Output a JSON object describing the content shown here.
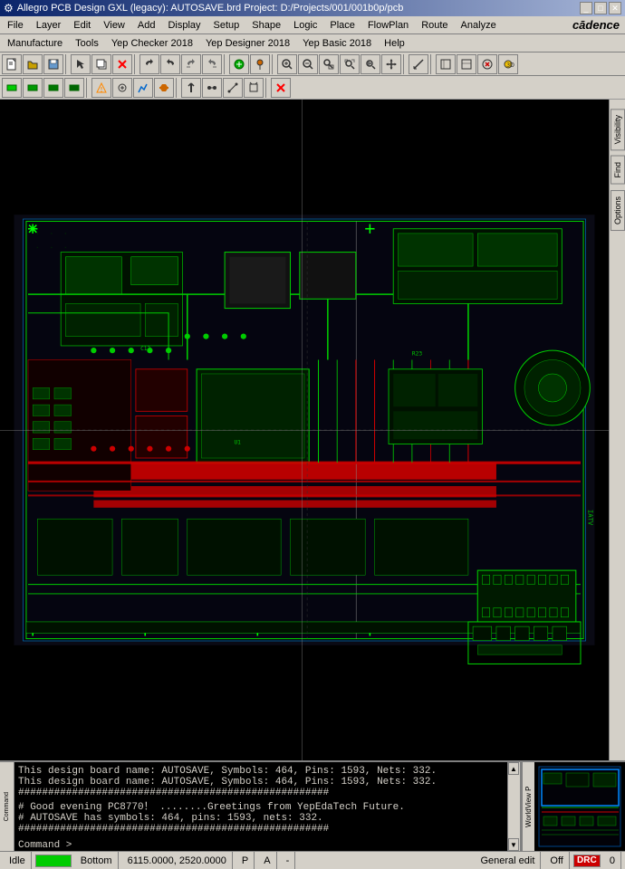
{
  "titlebar": {
    "title": "Allegro PCB Design GXL (legacy): AUTOSAVE.brd  Project: D:/Projects/001/001b0p/pcb",
    "min_label": "_",
    "max_label": "□",
    "close_label": "✕"
  },
  "menubar1": {
    "items": [
      "File",
      "Layer",
      "Edit",
      "View",
      "Add",
      "Display",
      "Setup",
      "Shape",
      "Logic",
      "Place",
      "FlowPlan",
      "Route",
      "Analyze"
    ]
  },
  "menubar2": {
    "items": [
      "Manufacture",
      "Tools",
      "Yep Checker 2018",
      "Yep Designer 2018",
      "Yep Basic 2018",
      "Help"
    ]
  },
  "cadence_logo": "cādence",
  "right_tabs": {
    "visibility": "Visibility",
    "find": "Find",
    "options": "Options"
  },
  "console": {
    "lines": [
      "  This design board name: AUTOSAVE, Symbols: 464, Pins: 1593, Nets: 332.",
      "  This design board name: AUTOSAVE, Symbols: 464, Pins: 1593, Nets: 332.",
      "  ####################################################",
      "  # Good evening PC8770！       ........Greetings from YepEdaTech Future.",
      "  # AUTOSAVE has symbols: 464, pins: 1593, nets: 332.",
      "  ####################################################"
    ],
    "prompt": "Command >"
  },
  "statusbar": {
    "idle": "Idle",
    "layer": "Bottom",
    "coords": "6115.0000, 2520.0000",
    "coord_mode": "P",
    "unit": "A",
    "dash": "-",
    "mode": "General edit",
    "off_label": "Off",
    "drc_label": "DRC",
    "count": "0"
  },
  "toolbar1_icons": [
    "new",
    "open",
    "save",
    "select",
    "copy",
    "delete",
    "undo",
    "redo",
    "undo2",
    "redo2",
    "ratsnest",
    "pin",
    "zoom-in",
    "zoom-out",
    "zoom-box",
    "zoom-fit",
    "zoom-prev",
    "pan",
    "measure",
    "custom1",
    "custom2",
    "custom3",
    "custom4",
    "custom5",
    "custom6",
    "custom7",
    "custom8",
    "custom9",
    "custom10",
    "custom11",
    "3d"
  ],
  "toolbar2_icons": [
    "layer1",
    "layer2",
    "layer3",
    "layer4",
    "layer5",
    "custom-a",
    "custom-b",
    "custom-c",
    "custom-d",
    "custom-e",
    "custom-f",
    "custom-g",
    "custom-h",
    "custom-i",
    "custom-j",
    "custom-k",
    "custom-l",
    "custom-m",
    "custom-n",
    "custom-o",
    "delete-x"
  ]
}
